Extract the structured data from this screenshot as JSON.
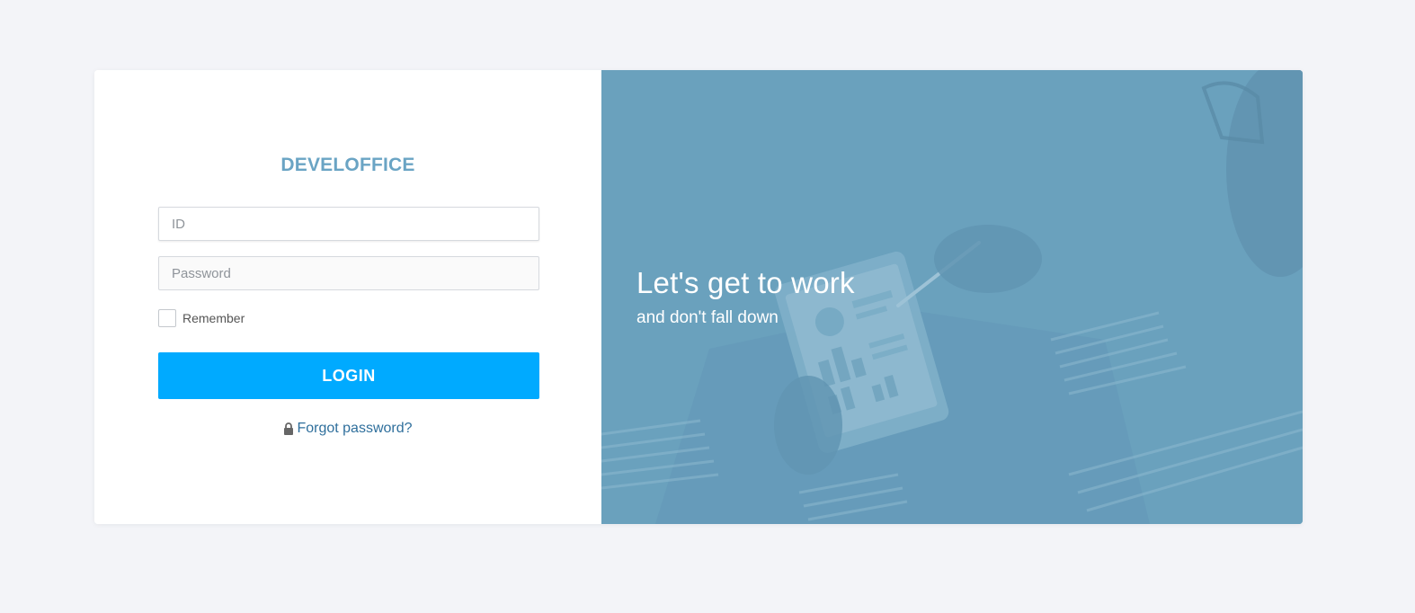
{
  "brand": {
    "title": "DEVELOFFICE"
  },
  "form": {
    "id_placeholder": "ID",
    "id_value": "",
    "password_placeholder": "Password",
    "password_value": "",
    "remember_label": "Remember",
    "remember_checked": false,
    "login_label": "LOGIN",
    "forgot_label": "Forgot password?",
    "forgot_icon": "lock-icon"
  },
  "hero": {
    "heading": "Let's get to work",
    "subheading": "and don't fall down"
  },
  "colors": {
    "page_background": "#f3f4f8",
    "brand": "#6aa4c4",
    "primary_button": "#00aaff",
    "link": "#2f6f9c",
    "hero_overlay": "#6aa1be"
  }
}
